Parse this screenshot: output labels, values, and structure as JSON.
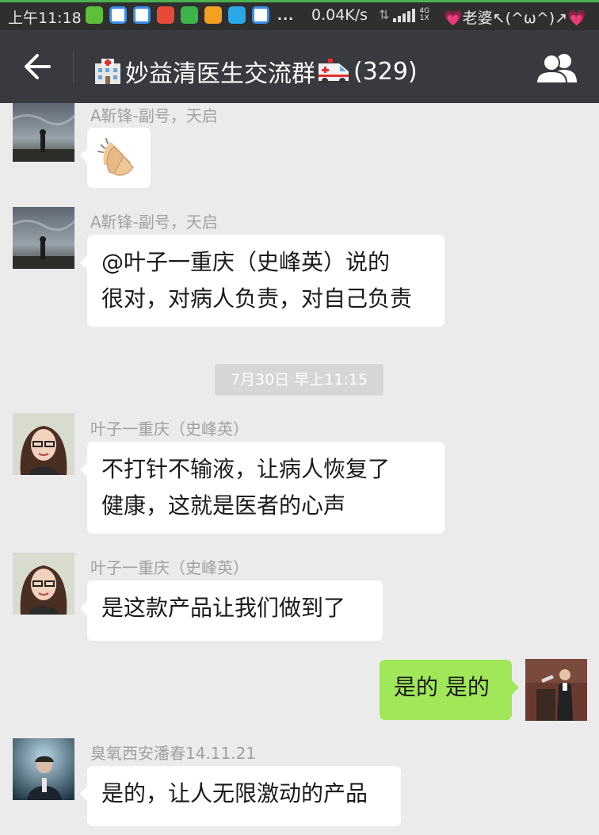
{
  "status_bar": {
    "time": "上午11:18",
    "app_icons": [
      "wechat-icon",
      "baidu-icon",
      "baidu-icon",
      "video-icon",
      "video-icon",
      "app-icon",
      "app-icon",
      "app-icon"
    ],
    "more": "...",
    "speed": "0.04K/s",
    "network_tech_top": "4G",
    "network_tech_bottom": "1X",
    "carrier_prefix": "💗",
    "carrier": "老婆↖(^ω^)↗",
    "carrier_suffix": "💗"
  },
  "header": {
    "title": "妙益清医生交流群",
    "member_count": "(329)",
    "back_icon": "back-arrow-icon",
    "group_icon": "group-members-icon"
  },
  "chat": {
    "timestamp": "7月30日 早上11:15",
    "messages": [
      {
        "sender": "A靳锋-副号，天启",
        "emoji": "clapping-hands"
      },
      {
        "sender": "A靳锋-副号，天启",
        "lines": [
          "@叶子一重庆（史峰英）说的",
          "很对，对病人负责，对自己负责"
        ]
      },
      {
        "sender": "叶子一重庆（史峰英）",
        "lines": [
          "不打针不输液，让病人恢复了",
          "健康，这就是医者的心声"
        ]
      },
      {
        "sender": "叶子一重庆（史峰英）",
        "lines": [
          "是这款产品让我们做到了"
        ]
      },
      {
        "sender": "",
        "lines": [
          "是的  是的"
        ]
      },
      {
        "sender": "臭氧西安潘春14.11.21",
        "lines": [
          "是的，让人无限激动的产品"
        ]
      }
    ]
  },
  "colors": {
    "header_bg": "#393a3f",
    "chat_bg": "#ebebeb",
    "my_bubble": "#a0e75a",
    "other_bubble": "#ffffff"
  }
}
